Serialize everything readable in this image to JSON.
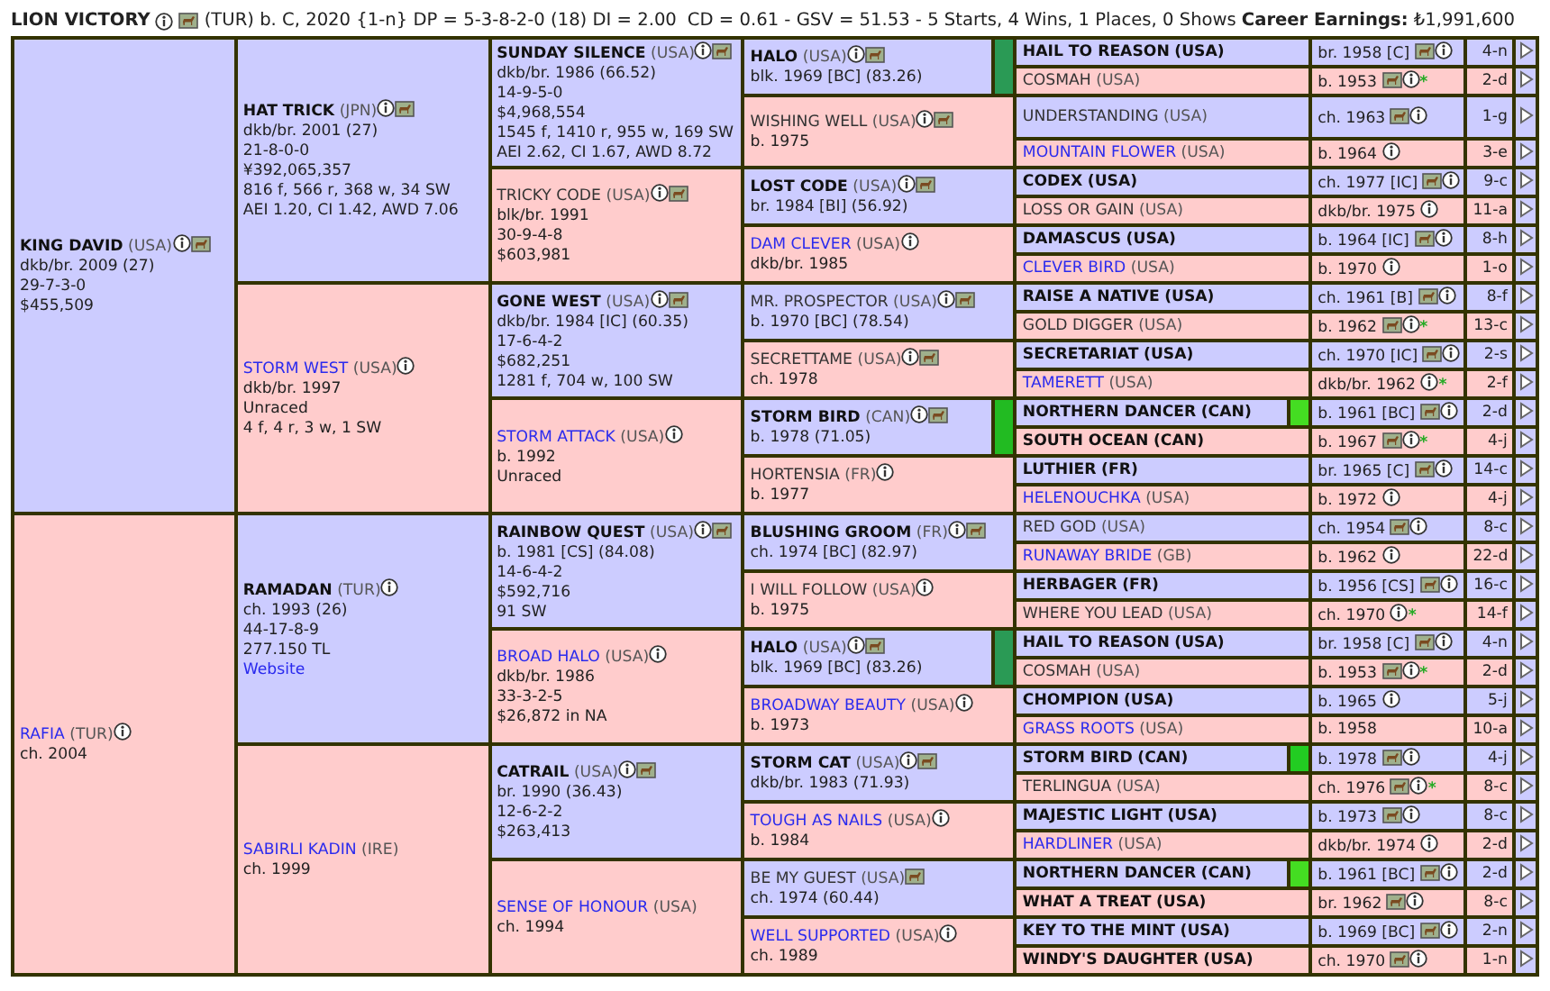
{
  "header": {
    "name": "LION VICTORY",
    "info": true,
    "photo": true,
    "summary": "(TUR) b. C, 2020 {1-n} DP = 5-3-8-2-0 (18) DI = 2.00",
    "stats": "CD = 0.61 - GSV = 51.53 - 5 Starts, 4 Wins, 1 Places, 0 Shows",
    "earnings": "**Career Earnings:** ₺1,991,600"
  },
  "pedigree": [
    {
      "name": "KING DAVID",
      "country": "(USA)",
      "kind": "bold",
      "info": true,
      "photo": true,
      "lines": [
        "dkb/br. 2009 (27)",
        "29-7-3-0",
        "$455,509"
      ],
      "parents": [
        {
          "name": "HAT TRICK",
          "country": "(JPN)",
          "kind": "bold",
          "info": true,
          "photo": true,
          "lines": [
            "dkb/br. 2001 (27)",
            "21-8-0-0",
            "¥392,065,357",
            "816 f, 566 r, 368 w, 34 SW",
            "AEI 1.20, CI 1.42, AWD 7.06"
          ],
          "parents": [
            {
              "name": "SUNDAY SILENCE",
              "country": "(USA)",
              "kind": "bold",
              "info": true,
              "photo": true,
              "lines": [
                "dkb/br. 1986 (66.52)",
                "14-9-5-0",
                "$4,968,554",
                "1545 f, 1410 r, 955 w, 169 SW",
                "AEI 2.62, CI 1.67, AWD 8.72"
              ],
              "parents": [
                {
                  "name": "HALO",
                  "country": "(USA)",
                  "kind": "bold",
                  "info": true,
                  "photo": true,
                  "color": "#2a9a55",
                  "lines": [
                    "blk. 1969 [BC] (83.26)"
                  ],
                  "parents": [
                    {
                      "name": "HAIL TO REASON",
                      "country": "(USA)",
                      "kind": "bold",
                      "detail": "br. 1958 [C]",
                      "photo": true,
                      "info": true,
                      "family": "4-n"
                    },
                    {
                      "name": "COSMAH",
                      "country": "(USA)",
                      "kind": "plain",
                      "detail": "b. 1953",
                      "photo": true,
                      "info": true,
                      "note": "*",
                      "family": "2-d"
                    }
                  ]
                },
                {
                  "name": "WISHING WELL",
                  "country": "(USA)",
                  "kind": "plain",
                  "info": true,
                  "photo": true,
                  "lines": [
                    "b. 1975"
                  ],
                  "parents": [
                    {
                      "name": "UNDERSTANDING",
                      "country": "(USA)",
                      "kind": "plain",
                      "detail": "ch. 1963",
                      "photo": true,
                      "info": true,
                      "family": "1-g"
                    },
                    {
                      "name": "MOUNTAIN FLOWER",
                      "country": "(USA)",
                      "kind": "link",
                      "detail": "b. 1964",
                      "info": true,
                      "family": "3-e"
                    }
                  ]
                }
              ]
            },
            {
              "name": "TRICKY CODE",
              "country": "(USA)",
              "kind": "plain",
              "info": true,
              "photo": true,
              "lines": [
                "blk/br. 1991",
                "30-9-4-8",
                "$603,981"
              ],
              "parents": [
                {
                  "name": "LOST CODE",
                  "country": "(USA)",
                  "kind": "bold",
                  "info": true,
                  "photo": true,
                  "lines": [
                    "br. 1984 [BI] (56.92)"
                  ],
                  "parents": [
                    {
                      "name": "CODEX",
                      "country": "(USA)",
                      "kind": "bold",
                      "detail": "ch. 1977 [IC]",
                      "photo": true,
                      "info": true,
                      "family": "9-c"
                    },
                    {
                      "name": "LOSS OR GAIN",
                      "country": "(USA)",
                      "kind": "plain",
                      "detail": "dkb/br. 1975",
                      "info": true,
                      "family": "11-a"
                    }
                  ]
                },
                {
                  "name": "DAM CLEVER",
                  "country": "(USA)",
                  "kind": "link",
                  "info": true,
                  "lines": [
                    "dkb/br. 1985"
                  ],
                  "parents": [
                    {
                      "name": "DAMASCUS",
                      "country": "(USA)",
                      "kind": "bold",
                      "detail": "b. 1964 [IC]",
                      "photo": true,
                      "info": true,
                      "family": "8-h"
                    },
                    {
                      "name": "CLEVER BIRD",
                      "country": "(USA)",
                      "kind": "link",
                      "detail": "b. 1970",
                      "info": true,
                      "family": "1-o"
                    }
                  ]
                }
              ]
            }
          ]
        },
        {
          "name": "STORM WEST",
          "country": "(USA)",
          "kind": "link",
          "info": true,
          "lines": [
            "dkb/br. 1997",
            "Unraced",
            "4 f, 4 r, 3 w, 1 SW"
          ],
          "parents": [
            {
              "name": "GONE WEST",
              "country": "(USA)",
              "kind": "bold",
              "info": true,
              "photo": true,
              "lines": [
                "dkb/br. 1984 [IC] (60.35)",
                "17-6-4-2",
                "$682,251",
                "1281 f, 704 w, 100 SW"
              ],
              "parents": [
                {
                  "name": "MR. PROSPECTOR",
                  "country": "(USA)",
                  "kind": "plain",
                  "info": true,
                  "photo": true,
                  "lines": [
                    "b. 1970 [BC] (78.54)"
                  ],
                  "parents": [
                    {
                      "name": "RAISE A NATIVE",
                      "country": "(USA)",
                      "kind": "bold",
                      "detail": "ch. 1961 [B]",
                      "photo": true,
                      "info": true,
                      "family": "8-f"
                    },
                    {
                      "name": "GOLD DIGGER",
                      "country": "(USA)",
                      "kind": "plain",
                      "detail": "b. 1962",
                      "photo": true,
                      "info": true,
                      "note": "*",
                      "family": "13-c"
                    }
                  ]
                },
                {
                  "name": "SECRETTAME",
                  "country": "(USA)",
                  "kind": "plain",
                  "info": true,
                  "photo": true,
                  "lines": [
                    "ch. 1978"
                  ],
                  "parents": [
                    {
                      "name": "SECRETARIAT",
                      "country": "(USA)",
                      "kind": "bold",
                      "detail": "ch. 1970 [IC]",
                      "photo": true,
                      "info": true,
                      "family": "2-s"
                    },
                    {
                      "name": "TAMERETT",
                      "country": "(USA)",
                      "kind": "link",
                      "detail": "dkb/br. 1962",
                      "info": true,
                      "note": "*",
                      "family": "2-f"
                    }
                  ]
                }
              ]
            },
            {
              "name": "STORM ATTACK",
              "country": "(USA)",
              "kind": "link",
              "info": true,
              "lines": [
                "b. 1992",
                "Unraced"
              ],
              "parents": [
                {
                  "name": "STORM BIRD",
                  "country": "(CAN)",
                  "kind": "bold",
                  "info": true,
                  "photo": true,
                  "color": "#22bb22",
                  "lines": [
                    "b. 1978 (71.05)"
                  ],
                  "parents": [
                    {
                      "name": "NORTHERN DANCER",
                      "country": "(CAN)",
                      "kind": "bold",
                      "color": "#44dd22",
                      "detail": "b. 1961 [BC]",
                      "photo": true,
                      "info": true,
                      "family": "2-d"
                    },
                    {
                      "name": "SOUTH OCEAN",
                      "country": "(CAN)",
                      "kind": "bold",
                      "detail": "b. 1967",
                      "photo": true,
                      "info": true,
                      "note": "*",
                      "family": "4-j"
                    }
                  ]
                },
                {
                  "name": "HORTENSIA",
                  "country": "(FR)",
                  "kind": "plain",
                  "info": true,
                  "lines": [
                    "b. 1977"
                  ],
                  "parents": [
                    {
                      "name": "LUTHIER",
                      "country": "(FR)",
                      "kind": "bold",
                      "detail": "br. 1965 [C]",
                      "photo": true,
                      "info": true,
                      "family": "14-c"
                    },
                    {
                      "name": "HELENOUCHKA",
                      "country": "(USA)",
                      "kind": "link",
                      "detail": "b. 1972",
                      "info": true,
                      "family": "4-j"
                    }
                  ]
                }
              ]
            }
          ]
        }
      ]
    },
    {
      "name": "RAFIA",
      "country": "(TUR)",
      "kind": "link",
      "info": true,
      "lines": [
        "ch. 2004"
      ],
      "parents": [
        {
          "name": "RAMADAN",
          "country": "(TUR)",
          "kind": "bold",
          "info": true,
          "lines": [
            "ch. 1993 (26)",
            "44-17-8-9",
            "277.150 TL"
          ],
          "website": "Website",
          "parents": [
            {
              "name": "RAINBOW QUEST",
              "country": "(USA)",
              "kind": "bold",
              "info": true,
              "photo": true,
              "lines": [
                "b. 1981 [CS] (84.08)",
                "14-6-4-2",
                "$592,716",
                "91 SW"
              ],
              "parents": [
                {
                  "name": "BLUSHING GROOM",
                  "country": "(FR)",
                  "kind": "bold",
                  "info": true,
                  "photo": true,
                  "lines": [
                    "ch. 1974 [BC] (82.97)"
                  ],
                  "parents": [
                    {
                      "name": "RED GOD",
                      "country": "(USA)",
                      "kind": "plain",
                      "detail": "ch. 1954",
                      "photo": true,
                      "info": true,
                      "family": "8-c"
                    },
                    {
                      "name": "RUNAWAY BRIDE",
                      "country": "(GB)",
                      "kind": "link",
                      "detail": "b. 1962",
                      "info": true,
                      "family": "22-d"
                    }
                  ]
                },
                {
                  "name": "I WILL FOLLOW",
                  "country": "(USA)",
                  "kind": "plain",
                  "info": true,
                  "lines": [
                    "b. 1975"
                  ],
                  "parents": [
                    {
                      "name": "HERBAGER",
                      "country": "(FR)",
                      "kind": "bold",
                      "detail": "b. 1956 [CS]",
                      "photo": true,
                      "info": true,
                      "family": "16-c"
                    },
                    {
                      "name": "WHERE YOU LEAD",
                      "country": "(USA)",
                      "kind": "plain",
                      "detail": "ch. 1970",
                      "info": true,
                      "note": "*",
                      "family": "14-f"
                    }
                  ]
                }
              ]
            },
            {
              "name": "BROAD HALO",
              "country": "(USA)",
              "kind": "link",
              "info": true,
              "lines": [
                "dkb/br. 1986",
                "33-3-2-5",
                "$26,872 in NA"
              ],
              "parents": [
                {
                  "name": "HALO",
                  "country": "(USA)",
                  "kind": "bold",
                  "info": true,
                  "photo": true,
                  "color": "#2a9a55",
                  "lines": [
                    "blk. 1969 [BC] (83.26)"
                  ],
                  "parents": [
                    {
                      "name": "HAIL TO REASON",
                      "country": "(USA)",
                      "kind": "bold",
                      "detail": "br. 1958 [C]",
                      "photo": true,
                      "info": true,
                      "family": "4-n"
                    },
                    {
                      "name": "COSMAH",
                      "country": "(USA)",
                      "kind": "plain",
                      "detail": "b. 1953",
                      "photo": true,
                      "info": true,
                      "note": "*",
                      "family": "2-d"
                    }
                  ]
                },
                {
                  "name": "BROADWAY BEAUTY",
                  "country": "(USA)",
                  "kind": "link",
                  "info": true,
                  "lines": [
                    "b. 1973"
                  ],
                  "parents": [
                    {
                      "name": "CHOMPION",
                      "country": "(USA)",
                      "kind": "bold",
                      "detail": "b. 1965",
                      "info": true,
                      "family": "5-j"
                    },
                    {
                      "name": "GRASS ROOTS",
                      "country": "(USA)",
                      "kind": "link",
                      "detail": "b. 1958",
                      "family": "10-a"
                    }
                  ]
                }
              ]
            }
          ]
        },
        {
          "name": "SABIRLI KADIN",
          "country": "(IRE)",
          "kind": "link",
          "lines": [
            "ch. 1999"
          ],
          "parents": [
            {
              "name": "CATRAIL",
              "country": "(USA)",
              "kind": "bold",
              "info": true,
              "photo": true,
              "lines": [
                "br. 1990 (36.43)",
                "12-6-2-2",
                "$263,413"
              ],
              "parents": [
                {
                  "name": "STORM CAT",
                  "country": "(USA)",
                  "kind": "bold",
                  "info": true,
                  "photo": true,
                  "lines": [
                    "dkb/br. 1983 (71.93)"
                  ],
                  "parents": [
                    {
                      "name": "STORM BIRD",
                      "country": "(CAN)",
                      "kind": "bold",
                      "color": "#22cc22",
                      "detail": "b. 1978",
                      "photo": true,
                      "info": true,
                      "family": "4-j"
                    },
                    {
                      "name": "TERLINGUA",
                      "country": "(USA)",
                      "kind": "plain",
                      "detail": "ch. 1976",
                      "photo": true,
                      "info": true,
                      "note": "*",
                      "family": "8-c"
                    }
                  ]
                },
                {
                  "name": "TOUGH AS NAILS",
                  "country": "(USA)",
                  "kind": "link",
                  "info": true,
                  "lines": [
                    "b. 1984"
                  ],
                  "parents": [
                    {
                      "name": "MAJESTIC LIGHT",
                      "country": "(USA)",
                      "kind": "bold",
                      "detail": "b. 1973",
                      "photo": true,
                      "info": true,
                      "family": "8-c"
                    },
                    {
                      "name": "HARDLINER",
                      "country": "(USA)",
                      "kind": "link",
                      "detail": "dkb/br. 1974",
                      "info": true,
                      "family": "2-d"
                    }
                  ]
                }
              ]
            },
            {
              "name": "SENSE OF HONOUR",
              "country": "(USA)",
              "kind": "link",
              "lines": [
                "ch. 1994"
              ],
              "parents": [
                {
                  "name": "BE MY GUEST",
                  "country": "(USA)",
                  "kind": "plain",
                  "photo": true,
                  "lines": [
                    "ch. 1974 (60.44)"
                  ],
                  "parents": [
                    {
                      "name": "NORTHERN DANCER",
                      "country": "(CAN)",
                      "kind": "bold",
                      "color": "#44dd22",
                      "detail": "b. 1961 [BC]",
                      "photo": true,
                      "info": true,
                      "family": "2-d"
                    },
                    {
                      "name": "WHAT A TREAT",
                      "country": "(USA)",
                      "kind": "bold",
                      "detail": "br. 1962",
                      "photo": true,
                      "info": true,
                      "family": "8-c"
                    }
                  ]
                },
                {
                  "name": "WELL SUPPORTED",
                  "country": "(USA)",
                  "kind": "link",
                  "info": true,
                  "lines": [
                    "ch. 1989"
                  ],
                  "parents": [
                    {
                      "name": "KEY TO THE MINT",
                      "country": "(USA)",
                      "kind": "bold",
                      "detail": "b. 1969 [BC]",
                      "photo": true,
                      "info": true,
                      "family": "2-n"
                    },
                    {
                      "name": "WINDY'S DAUGHTER",
                      "country": "(USA)",
                      "kind": "bold",
                      "detail": "ch. 1970",
                      "photo": true,
                      "info": true,
                      "family": "1-n"
                    }
                  ]
                }
              ]
            }
          ]
        }
      ]
    }
  ]
}
